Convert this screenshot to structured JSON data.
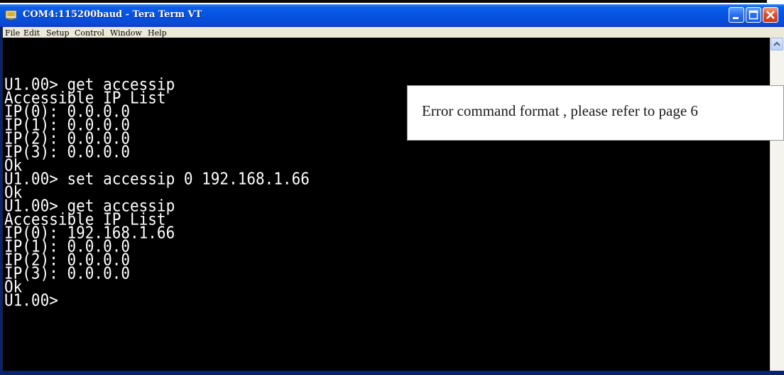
{
  "window": {
    "title": "COM4:115200baud - Tera Term VT",
    "icon": "tera-term-icon",
    "buttons": [
      "minimize-icon",
      "maximize-icon",
      "close-icon"
    ]
  },
  "menu": [
    "File",
    "Edit",
    "Setup",
    "Control",
    "Window",
    "Help"
  ],
  "terminal": {
    "lines": [
      "U1.00> get accessip",
      "Accessible IP List",
      "IP(0): 0.0.0.0",
      "IP(1): 0.0.0.0",
      "IP(2): 0.0.0.0",
      "IP(3): 0.0.0.0",
      "Ok",
      "U1.00> set accessip 0 192.168.1.66",
      "Ok",
      "U1.00> get accessip",
      "Accessible IP List",
      "IP(0): 192.168.1.66",
      "IP(1): 0.0.0.0",
      "IP(2): 0.0.0.0",
      "IP(3): 0.0.0.0",
      "Ok",
      "U1.00>"
    ]
  },
  "callout": {
    "text": "Error command format , please refer to page 6"
  },
  "colors": {
    "terminal_bg": "#000000",
    "terminal_fg": "#ffffff",
    "titlebar": "#0a5fe8",
    "menubar": "#ece9d8"
  }
}
